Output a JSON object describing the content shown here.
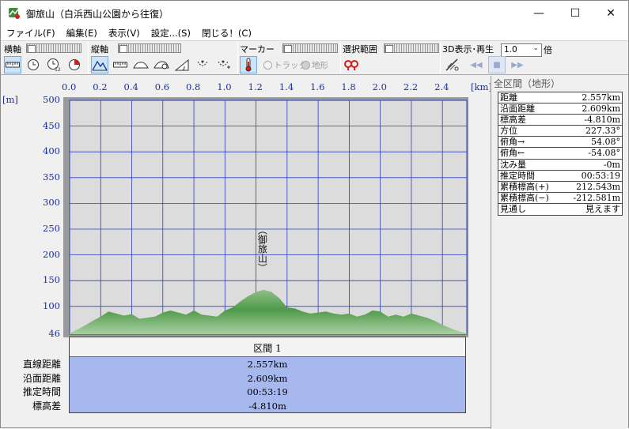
{
  "window": {
    "title": "御旅山（白浜西山公園から往復）",
    "controls": [
      "—",
      "☐",
      "✕"
    ]
  },
  "menu": [
    "ファイル(F)",
    "編集(E)",
    "表示(V)",
    "設定...(S)",
    "閉じる！(C)"
  ],
  "toolbar": {
    "horizontal_axis_label": "横軸",
    "vertical_axis_label": "縦軸",
    "marker_label": "マーカー",
    "selection_label": "選択範囲",
    "display3d_label": "3D表示･再生",
    "radio_track": "トラック",
    "radio_terrain": "地形",
    "speed_value": "1.0",
    "speed_unit": "倍",
    "play_prev": "◀◀",
    "play_stop": "■",
    "play_next": "▶▶"
  },
  "chart_data": {
    "type": "area",
    "x_unit_label": "[km]",
    "y_unit_label": "[m]",
    "x_ticks": [
      "0.0",
      "0.2",
      "0.4",
      "0.6",
      "0.8",
      "1.0",
      "1.2",
      "1.4",
      "1.6",
      "1.8",
      "2.0",
      "2.2",
      "2.4"
    ],
    "y_ticks": [
      "500",
      "450",
      "400",
      "350",
      "300",
      "250",
      "200",
      "150",
      "100",
      "46"
    ],
    "xlim": [
      0.0,
      2.557
    ],
    "ylim": [
      46,
      500
    ],
    "grid": true,
    "peak_label": "（御旅山）",
    "series": [
      {
        "x": [
          0.0,
          0.05,
          0.1,
          0.15,
          0.2,
          0.25,
          0.3,
          0.35,
          0.4,
          0.45,
          0.5,
          0.55,
          0.6,
          0.65,
          0.7,
          0.75,
          0.8,
          0.85,
          0.9,
          0.95,
          1.0,
          1.05,
          1.1,
          1.15,
          1.2,
          1.25,
          1.3,
          1.35,
          1.4,
          1.45,
          1.5,
          1.55,
          1.6,
          1.65,
          1.7,
          1.75,
          1.8,
          1.85,
          1.9,
          1.95,
          2.0,
          2.05,
          2.1,
          2.15,
          2.2,
          2.25,
          2.3,
          2.35,
          2.4,
          2.45,
          2.5,
          2.557
        ],
        "y": [
          48,
          55,
          63,
          72,
          80,
          90,
          86,
          82,
          85,
          76,
          78,
          80,
          88,
          92,
          88,
          84,
          92,
          84,
          82,
          80,
          92,
          98,
          110,
          120,
          128,
          132,
          128,
          116,
          98,
          96,
          90,
          86,
          88,
          90,
          86,
          84,
          86,
          80,
          84,
          92,
          90,
          80,
          84,
          80,
          86,
          82,
          78,
          72,
          64,
          58,
          52,
          48
        ]
      }
    ]
  },
  "summary": {
    "header": "区間 1",
    "labels": [
      "直線距離",
      "沿面距離",
      "推定時間",
      "標高差"
    ],
    "values": [
      "2.557km",
      "2.609km",
      "00:53:19",
      "-4.810m"
    ]
  },
  "info": {
    "title": "全区間（地形）",
    "rows": [
      {
        "label": "距離",
        "value": "2.557km"
      },
      {
        "label": "沿面距離",
        "value": "2.609km"
      },
      {
        "label": "標高差",
        "value": "-4.810m"
      },
      {
        "label": "方位",
        "value": "227.33°"
      },
      {
        "label": "俯角→",
        "value": "54.08°"
      },
      {
        "label": "俯角←",
        "value": "-54.08°"
      },
      {
        "label": "沈み量",
        "value": "-0m"
      },
      {
        "label": "推定時間",
        "value": "00:53:19"
      },
      {
        "label": "累積標高(+)",
        "value": "212.543m"
      },
      {
        "label": "累積標高(−)",
        "value": "-212.581m"
      },
      {
        "label": "見通し",
        "value": "見えます"
      }
    ]
  },
  "colors": {
    "axis_text": "#1a2f9c",
    "grid": "#2d3ec4",
    "terrain_top": "#3e8a3a",
    "terrain_light": "#9fc59a",
    "summary_bg": "#a7b8ee",
    "marker_red": "#d31c1c"
  }
}
